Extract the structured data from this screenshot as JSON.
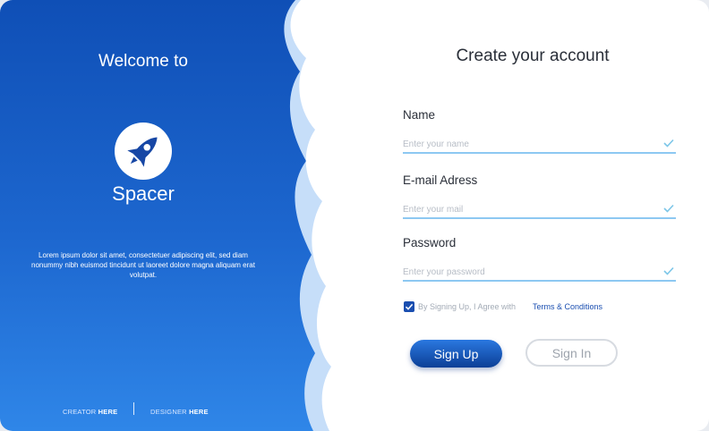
{
  "left_panel": {
    "welcome": "Welcome to",
    "logo_icon": "rocket-icon",
    "brand": "Spacer",
    "description": "Lorem ipsum dolor sit amet, consectetuer adipiscing elit, sed diam nonummy nibh euismod tincidunt ut laoreet dolore magna aliquam erat volutpat.",
    "footer": {
      "creator_label": "CREATOR ",
      "creator_link": "HERE",
      "designer_label": "DESIGNER ",
      "designer_link": "HERE"
    }
  },
  "form": {
    "title": "Create your account",
    "fields": [
      {
        "label": "Name",
        "placeholder": "Enter your name",
        "value": ""
      },
      {
        "label": "E-mail Adress",
        "placeholder": "Enter your mail",
        "value": ""
      },
      {
        "label": "Password",
        "placeholder": "Enter your password",
        "value": ""
      }
    ],
    "agree": {
      "checked": true,
      "text": "By Signing Up, I Agree with",
      "link": "Terms & Conditions"
    },
    "buttons": {
      "sign_up": "Sign Up",
      "sign_in": "Sign In"
    }
  },
  "colors": {
    "primary": "#1a4eb0",
    "gradient_top": "#0f4fb6",
    "gradient_bottom": "#2f86e8",
    "field_line": "#8dc8f2",
    "check": "#7cc6e8"
  }
}
